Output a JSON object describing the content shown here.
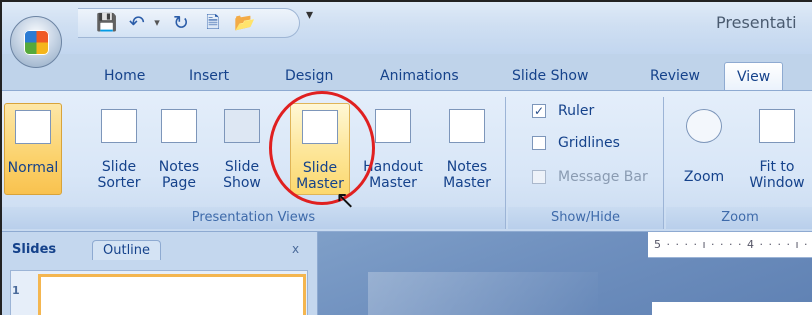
{
  "window": {
    "title": "Presentati"
  },
  "quick_access": {
    "save_icon": "save-icon",
    "undo_icon": "undo-icon",
    "redo_icon": "redo-icon",
    "print_preview_icon": "print-preview-icon",
    "open_icon": "open-folder-icon",
    "customize_glyph": "▾"
  },
  "tabs": [
    {
      "label": "Home"
    },
    {
      "label": "Insert"
    },
    {
      "label": "Design"
    },
    {
      "label": "Animations"
    },
    {
      "label": "Slide Show"
    },
    {
      "label": "Review"
    },
    {
      "label": "View",
      "active": true
    }
  ],
  "ribbon": {
    "presentation_views": {
      "label": "Presentation Views",
      "buttons": [
        {
          "line1": "Normal",
          "line2": "",
          "selected": true
        },
        {
          "line1": "Slide",
          "line2": "Sorter"
        },
        {
          "line1": "Notes",
          "line2": "Page"
        },
        {
          "line1": "Slide",
          "line2": "Show"
        },
        {
          "line1": "Slide",
          "line2": "Master",
          "hovered": true
        },
        {
          "line1": "Handout",
          "line2": "Master"
        },
        {
          "line1": "Notes",
          "line2": "Master"
        }
      ]
    },
    "show_hide": {
      "label": "Show/Hide",
      "checks": [
        {
          "label": "Ruler",
          "checked": true,
          "enabled": true
        },
        {
          "label": "Gridlines",
          "checked": false,
          "enabled": true
        },
        {
          "label": "Message Bar",
          "checked": false,
          "enabled": false
        }
      ]
    },
    "zoom": {
      "label": "Zoom",
      "buttons": [
        {
          "line1": "Zoom",
          "line2": ""
        },
        {
          "line1": "Fit to",
          "line2": "Window"
        }
      ]
    }
  },
  "panel": {
    "tabs": [
      "Slides",
      "Outline"
    ],
    "close": "x",
    "slide_number": "1"
  },
  "ruler": {
    "text": "5 · · · · ı · · · · 4 · · · · ı ·"
  },
  "colors": {
    "accent": "#15428b",
    "highlight_circle": "#e02020",
    "selected_button": "#fbd26c"
  }
}
